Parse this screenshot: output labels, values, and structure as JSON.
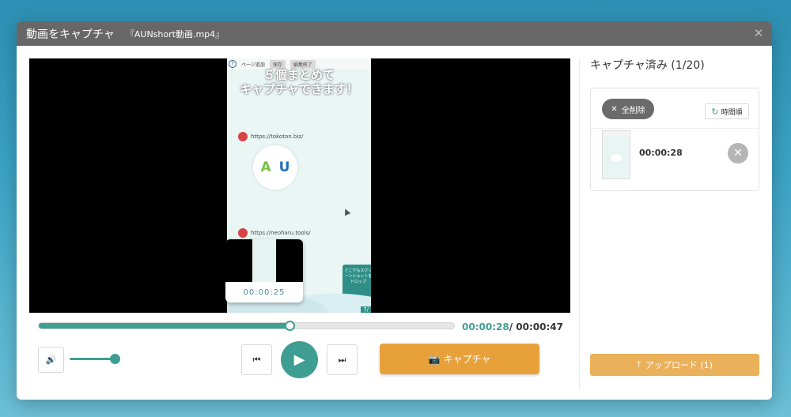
{
  "dialog": {
    "title": "動画をキャプチャ",
    "filename": "『AUNshort動画.mp4』",
    "close_icon": "✕"
  },
  "video": {
    "overlay": {
      "add_page": "ページ追加",
      "save": "保存",
      "finish_edit": "編集終了",
      "headline_line1": "５個まとめて",
      "headline_line2": "キャプチャできます！",
      "url1": "https://tokoton.biz/",
      "url2": "https://neoharu.tools/",
      "logo_a": "A",
      "logo_u": "U",
      "side_text": "どこでもスクリーンショットをドロップ",
      "page_num": "7/"
    },
    "preview_time": "00:00:25"
  },
  "playback": {
    "current_time": "00:00:28",
    "separator": "/ ",
    "total_time": "00:00:47",
    "progress_fraction": 0.603,
    "volume_fraction": 1.0
  },
  "controls": {
    "volume_icon": "🔊",
    "prev_icon": "⏮",
    "play_icon": "▶",
    "next_icon": "⏭",
    "capture_label": "キャプチャ",
    "capture_icon": "📷"
  },
  "captures": {
    "title": "キャプチャ済み (1/20)",
    "clear_all_label": "全削除",
    "clear_icon": "✕",
    "sort_label": "時間順",
    "sort_icon": "↻",
    "items": [
      {
        "time": "00:00:28",
        "delete_icon": "✕"
      }
    ]
  },
  "upload": {
    "label": "アップロード (1)",
    "icon": "⤒"
  },
  "colors": {
    "accent": "#3f9e93",
    "capture": "#e8a13a",
    "upload": "#ebb05a",
    "titlebar": "#676767"
  }
}
